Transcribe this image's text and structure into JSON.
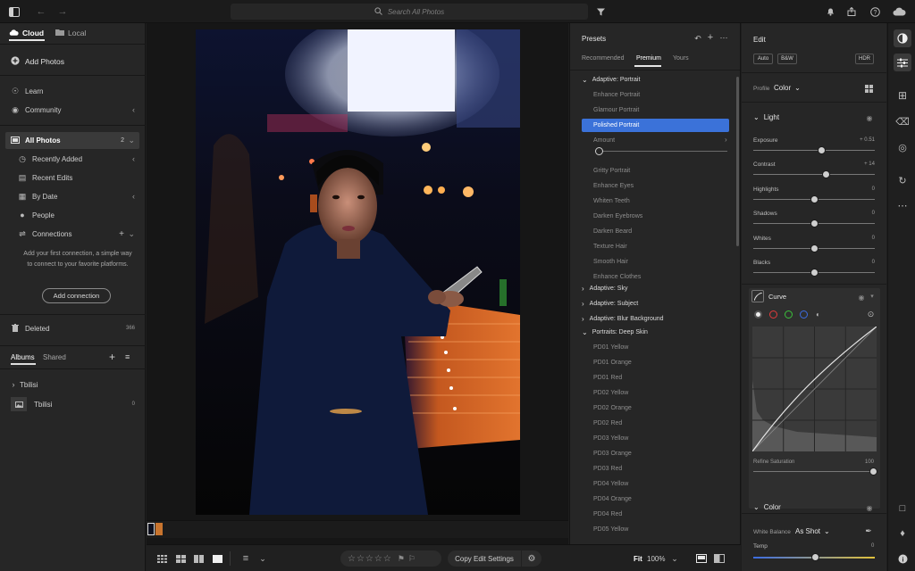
{
  "topbar": {
    "search_placeholder": "Search All Photos",
    "icons": [
      "panel-toggle-icon",
      "back-arrow-icon",
      "forward-arrow-icon",
      "search-icon",
      "filter-icon",
      "bell-icon",
      "share-icon",
      "help-icon",
      "cloud-icon"
    ]
  },
  "left": {
    "tab_cloud": "Cloud",
    "tab_local": "Local",
    "add_photos": "Add Photos",
    "learn": "Learn",
    "community": "Community",
    "all_photos": "All Photos",
    "all_photos_count": "2",
    "recently_added": "Recently Added",
    "recent_edits": "Recent Edits",
    "by_date": "By Date",
    "people": "People",
    "connections": "Connections",
    "connections_help": "Add your first connection, a simple way to connect to your favorite platforms.",
    "add_connection": "Add connection",
    "deleted": "Deleted",
    "deleted_count": "366",
    "albums_tab": "Albums",
    "shared_tab": "Shared",
    "folder_name": "Tbilisi",
    "album_name": "Tbilisi",
    "album_count": "0"
  },
  "presets": {
    "title": "Presets",
    "tabs": [
      "Recommended",
      "Premium",
      "Yours"
    ],
    "active_tab": "Premium",
    "group_adaptive_portrait": "Adaptive: Portrait",
    "items_top": [
      "Enhance Portrait",
      "Glamour Portrait"
    ],
    "selected": "Polished Portrait",
    "amount_label": "Amount",
    "amount_value": 0.0,
    "items_mid": [
      "Gritty Portrait",
      "Enhance Eyes",
      "Whiten Teeth",
      "Darken Eyebrows",
      "Darken Beard",
      "Texture Hair",
      "Smooth Hair",
      "Enhance Clothes"
    ],
    "groups_collapsed": [
      "Adaptive: Sky",
      "Adaptive: Subject",
      "Adaptive: Blur Background"
    ],
    "group_deep_skin": "Portraits: Deep Skin",
    "deep_skin_items": [
      "PD01 Yellow",
      "PD01 Orange",
      "PD01 Red",
      "PD02 Yellow",
      "PD02 Orange",
      "PD02 Red",
      "PD03 Yellow",
      "PD03 Orange",
      "PD03 Red",
      "PD04 Yellow",
      "PD04 Orange",
      "PD04 Red",
      "PD05 Yellow"
    ]
  },
  "edit": {
    "title": "Edit",
    "auto": "Auto",
    "bw": "B&W",
    "hdr": "HDR",
    "profile_label": "Profile",
    "profile_value": "Color",
    "light_section": "Light",
    "sliders": [
      {
        "label": "Exposure",
        "value": "+ 0.51",
        "pos": 0.56
      },
      {
        "label": "Contrast",
        "value": "+ 14",
        "pos": 0.6
      },
      {
        "label": "Highlights",
        "value": "0",
        "pos": 0.5
      },
      {
        "label": "Shadows",
        "value": "0",
        "pos": 0.5
      },
      {
        "label": "Whites",
        "value": "0",
        "pos": 0.5
      },
      {
        "label": "Blacks",
        "value": "0",
        "pos": 0.5
      }
    ],
    "curve_label": "Curve",
    "refine_saturation_label": "Refine Saturation",
    "refine_saturation_value": "100",
    "color_section": "Color",
    "white_balance_label": "White Balance",
    "white_balance_value": "As Shot",
    "temp_label": "Temp",
    "temp_value": "0"
  },
  "bottombar": {
    "copy_edit_settings": "Copy Edit Settings",
    "fit": "Fit",
    "zoom": "100%",
    "rating_stars": 0
  },
  "colors": {
    "accent_blue": "#3b72d9",
    "panel_bg": "#262626",
    "app_bg": "#1e1e1e"
  }
}
